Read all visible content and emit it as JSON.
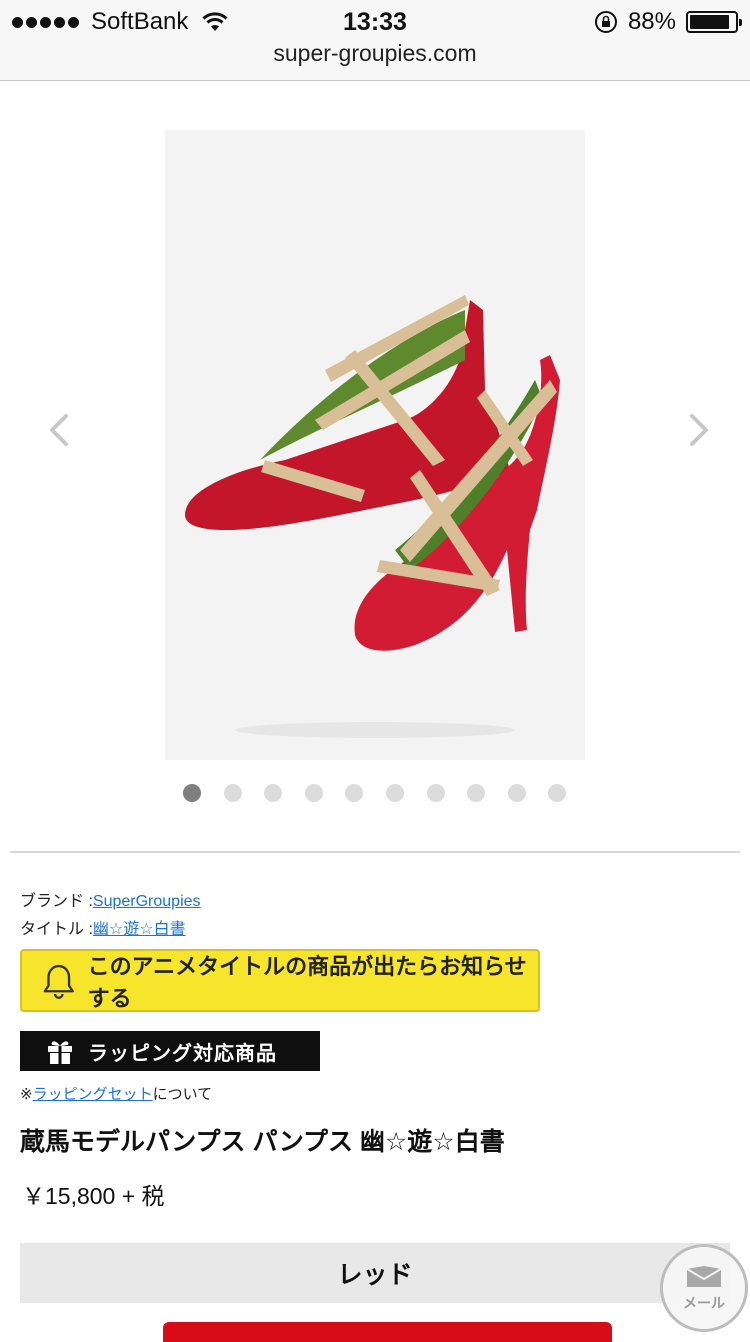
{
  "status_bar": {
    "carrier": "SoftBank",
    "time": "13:33",
    "battery_percent": "88%",
    "battery_level": 0.88,
    "signal_icon": "signal-dots-icon",
    "wifi_icon": "wifi-icon",
    "lock_icon": "rotation-lock-icon"
  },
  "browser": {
    "url": "super-groupies.com"
  },
  "carousel": {
    "image_alt": "Red patent pumps with studded beige straps",
    "prev_icon": "chevron-left-icon",
    "next_icon": "chevron-right-icon",
    "page_count": 10,
    "active_index": 0
  },
  "product": {
    "brand_label": "ブランド :",
    "brand_link": "SuperGroupies",
    "title_label": "タイトル :",
    "title_link": "幽☆遊☆白書",
    "notify_button": "このアニメタイトルの商品が出たらお知らせする",
    "notify_icon": "bell-icon",
    "wrapping_badge": "ラッピング対応商品",
    "wrapping_icon": "gift-icon",
    "wrap_note_prefix": "※",
    "wrap_note_link": "ラッピングセット",
    "wrap_note_suffix": "について",
    "name": "蔵馬モデルパンプス パンプス 幽☆遊☆白書",
    "price": "￥15,800 + 税",
    "variant": "レッド"
  },
  "fab": {
    "label": "メール",
    "icon": "envelope-icon"
  },
  "colors": {
    "notify_yellow": "#f6e52a",
    "link_blue": "#1a73d9",
    "cart_red": "#d80c18",
    "badge_black": "#0f0f0f"
  }
}
